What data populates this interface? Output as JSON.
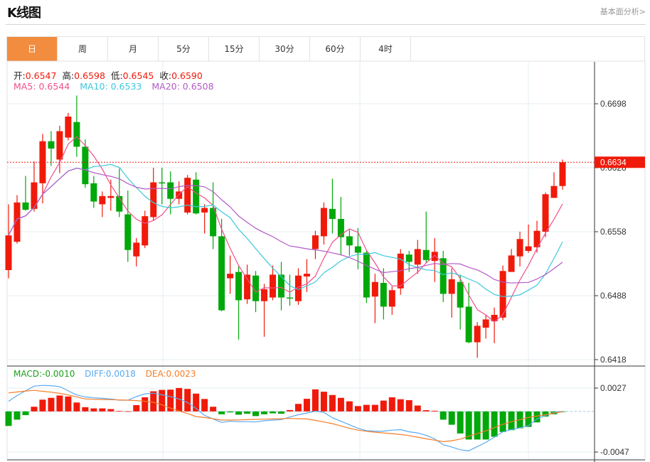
{
  "header": {
    "title": "K线图",
    "link": "基本面分析>"
  },
  "tabs": [
    {
      "label": "日",
      "active": true
    },
    {
      "label": "周"
    },
    {
      "label": "月"
    },
    {
      "label": "5分"
    },
    {
      "label": "15分"
    },
    {
      "label": "30分"
    },
    {
      "label": "60分"
    },
    {
      "label": "4时"
    }
  ],
  "legend": {
    "open_label": "开:",
    "open": "0.6547",
    "high_label": "高:",
    "high": "0.6598",
    "low_label": "低:",
    "low": "0.6545",
    "close_label": "收:",
    "close": "0.6590",
    "ma5": "MA5: 0.6544",
    "ma10": "MA10: 0.6533",
    "ma20": "MA20: 0.6508"
  },
  "macd_legend": {
    "macd": "MACD:-0.0010",
    "diff": "DIFF:0.0018",
    "dea": "DEA:0.0023"
  },
  "colors": {
    "up": "#f01a0a",
    "down": "#00a80a",
    "ma5": "#f0508c",
    "ma10": "#3cc8dc",
    "ma20": "#b45ac8",
    "diff": "#5aaaf0",
    "dea": "#f57d28",
    "accent": "#f28c3e"
  },
  "chart_data": [
    {
      "type": "candlestick",
      "price_ticks": [
        "0.6698",
        "0.6628",
        "0.6558",
        "0.6488",
        "0.6418"
      ],
      "ylim": [
        0.6418,
        0.6698
      ],
      "last_price": "0.6634",
      "grid": true,
      "moving_averages": [
        5,
        10,
        20
      ],
      "ohlc": [
        [
          0.6516,
          0.6588,
          0.6507,
          0.6554
        ],
        [
          0.6547,
          0.6598,
          0.6545,
          0.659
        ],
        [
          0.659,
          0.6619,
          0.6581,
          0.6582
        ],
        [
          0.6583,
          0.6635,
          0.658,
          0.6612
        ],
        [
          0.6611,
          0.6665,
          0.6589,
          0.6657
        ],
        [
          0.6657,
          0.6668,
          0.663,
          0.6649
        ],
        [
          0.6637,
          0.6674,
          0.6622,
          0.6668
        ],
        [
          0.6661,
          0.6688,
          0.6658,
          0.6684
        ],
        [
          0.6678,
          0.6707,
          0.664,
          0.6651
        ],
        [
          0.6651,
          0.6659,
          0.6606,
          0.661
        ],
        [
          0.6611,
          0.6619,
          0.6584,
          0.6591
        ],
        [
          0.6588,
          0.6602,
          0.6574,
          0.6597
        ],
        [
          0.6595,
          0.6615,
          0.6581,
          0.6597
        ],
        [
          0.6597,
          0.6627,
          0.6574,
          0.658
        ],
        [
          0.6577,
          0.6603,
          0.6525,
          0.6538
        ],
        [
          0.6531,
          0.6551,
          0.652,
          0.6546
        ],
        [
          0.6543,
          0.6581,
          0.654,
          0.6575
        ],
        [
          0.6574,
          0.6628,
          0.657,
          0.6612
        ],
        [
          0.6612,
          0.6628,
          0.6588,
          0.6611
        ],
        [
          0.6612,
          0.6624,
          0.6577,
          0.6594
        ],
        [
          0.6594,
          0.6613,
          0.6588,
          0.6602
        ],
        [
          0.6579,
          0.662,
          0.6577,
          0.6617
        ],
        [
          0.6615,
          0.6623,
          0.6577,
          0.6578
        ],
        [
          0.6579,
          0.6588,
          0.6556,
          0.6584
        ],
        [
          0.6584,
          0.6612,
          0.6539,
          0.6553
        ],
        [
          0.6553,
          0.6572,
          0.6471,
          0.6472
        ],
        [
          0.6507,
          0.6532,
          0.649,
          0.6512
        ],
        [
          0.6514,
          0.6521,
          0.644,
          0.6483
        ],
        [
          0.6484,
          0.6522,
          0.6479,
          0.6511
        ],
        [
          0.651,
          0.6515,
          0.647,
          0.6482
        ],
        [
          0.6482,
          0.6501,
          0.6443,
          0.6495
        ],
        [
          0.6486,
          0.6521,
          0.6483,
          0.6511
        ],
        [
          0.6511,
          0.6525,
          0.6472,
          0.6486
        ],
        [
          0.6486,
          0.6511,
          0.6477,
          0.6485
        ],
        [
          0.6482,
          0.6518,
          0.6478,
          0.651
        ],
        [
          0.6509,
          0.6528,
          0.6492,
          0.6512
        ],
        [
          0.6539,
          0.6559,
          0.6528,
          0.6554
        ],
        [
          0.6553,
          0.659,
          0.6544,
          0.6584
        ],
        [
          0.6583,
          0.6616,
          0.6556,
          0.6572
        ],
        [
          0.6572,
          0.6596,
          0.6533,
          0.6552
        ],
        [
          0.6553,
          0.656,
          0.6532,
          0.6543
        ],
        [
          0.6542,
          0.6562,
          0.6517,
          0.6535
        ],
        [
          0.6535,
          0.6537,
          0.648,
          0.6486
        ],
        [
          0.6487,
          0.6512,
          0.6458,
          0.6503
        ],
        [
          0.6502,
          0.6518,
          0.6462,
          0.6476
        ],
        [
          0.6476,
          0.6498,
          0.6467,
          0.6494
        ],
        [
          0.6496,
          0.6539,
          0.6489,
          0.6534
        ],
        [
          0.6533,
          0.6537,
          0.6514,
          0.6525
        ],
        [
          0.6522,
          0.6549,
          0.6512,
          0.6539
        ],
        [
          0.6538,
          0.658,
          0.6524,
          0.6527
        ],
        [
          0.6526,
          0.6551,
          0.6503,
          0.6536
        ],
        [
          0.6529,
          0.6537,
          0.6481,
          0.649
        ],
        [
          0.649,
          0.6518,
          0.6464,
          0.6506
        ],
        [
          0.6503,
          0.6511,
          0.6451,
          0.6475
        ],
        [
          0.6476,
          0.6502,
          0.6436,
          0.6437
        ],
        [
          0.6437,
          0.6459,
          0.642,
          0.6455
        ],
        [
          0.6453,
          0.6467,
          0.6441,
          0.6462
        ],
        [
          0.646,
          0.6475,
          0.6436,
          0.6467
        ],
        [
          0.6464,
          0.6521,
          0.6461,
          0.6515
        ],
        [
          0.6514,
          0.6539,
          0.6514,
          0.6532
        ],
        [
          0.6531,
          0.6558,
          0.652,
          0.655
        ],
        [
          0.6537,
          0.6566,
          0.6535,
          0.6542
        ],
        [
          0.6541,
          0.657,
          0.6535,
          0.6559
        ],
        [
          0.6558,
          0.6601,
          0.6552,
          0.6599
        ],
        [
          0.6595,
          0.6623,
          0.6595,
          0.6608
        ],
        [
          0.6608,
          0.6637,
          0.6604,
          0.6634
        ]
      ]
    },
    {
      "type": "macd",
      "ticks": [
        "0.0027",
        "-0.0047"
      ],
      "ylim": [
        -0.0047,
        0.0027
      ],
      "macd": [
        -0.00168,
        -0.00095,
        -0.00043,
        0.00054,
        0.00136,
        0.00157,
        0.00184,
        0.00173,
        0.00103,
        0.00049,
        0.00035,
        0.00035,
        0.00027,
        5e-05,
        2e-05,
        0.00073,
        0.00163,
        0.00233,
        0.00249,
        0.00252,
        0.00271,
        0.0026,
        0.00206,
        0.00144,
        0.00054,
        -0.00033,
        -0.00011,
        -0.00038,
        -0.00027,
        -0.00054,
        -0.00033,
        -0.00022,
        -0.00027,
        0.00016,
        0.00087,
        0.00146,
        0.00255,
        0.00228,
        0.0019,
        0.00157,
        0.00117,
        0.00062,
        0.00076,
        0.00076,
        0.00125,
        0.00163,
        0.00141,
        0.0013,
        0.00068,
        0.00014,
        8e-05,
        -0.00095,
        -0.00154,
        -0.00255,
        -0.00325,
        -0.00325,
        -0.00325,
        -0.00293,
        -0.00238,
        -0.00217,
        -0.00195,
        -0.00179,
        -0.00127,
        -0.0006,
        -0.00033,
        -2e-05
      ],
      "diff": [
        0.00117,
        0.00184,
        0.00238,
        0.00293,
        0.00301,
        0.00298,
        0.00287,
        0.00238,
        0.0019,
        0.00168,
        0.00157,
        0.00152,
        0.00144,
        0.0013,
        0.0013,
        0.00171,
        0.00203,
        0.00211,
        0.00192,
        0.00171,
        0.00144,
        0.00103,
        0.00035,
        -0.00046,
        -0.00087,
        -0.00127,
        -0.00114,
        -0.00119,
        -0.00119,
        -0.00122,
        -0.00108,
        -0.001,
        -0.00095,
        -0.00065,
        -0.00038,
        -0.00019,
        3e-05,
        -0.00011,
        -0.00073,
        -0.00114,
        -0.00154,
        -0.00195,
        -0.00222,
        -0.00228,
        -0.00228,
        -0.00217,
        -0.00211,
        -0.00236,
        -0.00249,
        -0.00276,
        -0.00317,
        -0.00385,
        -0.00412,
        -0.00444,
        -0.00455,
        -0.00407,
        -0.00358,
        -0.00298,
        -0.00236,
        -0.00209,
        -0.0019,
        -0.00163,
        -0.00087,
        -0.00046,
        -0.00011,
        0.0
      ],
      "dea": [
        0.00214,
        0.00225,
        0.00236,
        0.00244,
        0.00233,
        0.00222,
        0.00209,
        0.0019,
        0.00168,
        0.00144,
        0.00141,
        0.00138,
        0.00136,
        0.00133,
        0.0013,
        0.00125,
        0.00117,
        0.00106,
        0.00076,
        0.00038,
        5e-05,
        -0.00024,
        -0.0006,
        -0.0007,
        -0.00084,
        -0.001,
        -0.001,
        -0.00098,
        -0.00095,
        -0.00092,
        -0.00089,
        -0.00087,
        -0.00084,
        -0.00081,
        -0.00084,
        -0.00087,
        -0.00103,
        -0.00122,
        -0.00141,
        -0.00168,
        -0.00195,
        -0.00217,
        -0.0023,
        -0.00241,
        -0.00249,
        -0.00257,
        -0.00268,
        -0.00279,
        -0.00298,
        -0.00317,
        -0.00333,
        -0.0035,
        -0.00339,
        -0.0032,
        -0.00287,
        -0.00255,
        -0.00225,
        -0.00187,
        -0.00149,
        -0.00119,
        -0.00095,
        -0.0007,
        -0.00054,
        -0.00038,
        -0.00019,
        -5e-05
      ]
    }
  ]
}
